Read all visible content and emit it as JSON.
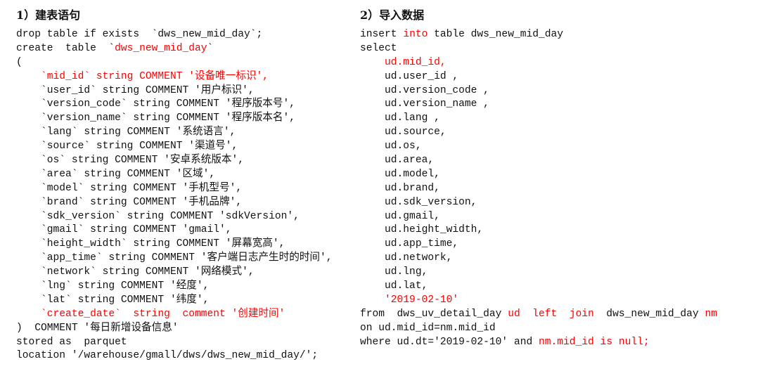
{
  "colors": {
    "keyword_highlight": "#ff0000",
    "text": "#111111"
  },
  "left": {
    "heading": "1）建表语句",
    "lines": [
      [
        {
          "t": "drop table if exists  `dws_new_mid_day`;"
        }
      ],
      [
        {
          "t": "create  table  `"
        },
        {
          "t": "dws_new_mid_day",
          "red": true
        },
        {
          "t": "`"
        }
      ],
      [
        {
          "t": "("
        }
      ],
      [
        {
          "t": "    "
        },
        {
          "t": "`mid_id` string COMMENT '设备唯一标识',",
          "red": true
        }
      ],
      [
        {
          "t": "    `user_id` string COMMENT '用户标识',"
        }
      ],
      [
        {
          "t": "    `version_code` string COMMENT '程序版本号',"
        }
      ],
      [
        {
          "t": "    `version_name` string COMMENT '程序版本名',"
        }
      ],
      [
        {
          "t": "    `lang` string COMMENT '系统语言',"
        }
      ],
      [
        {
          "t": "    `source` string COMMENT '渠道号',"
        }
      ],
      [
        {
          "t": "    `os` string COMMENT '安卓系统版本',"
        }
      ],
      [
        {
          "t": "    `area` string COMMENT '区域',"
        }
      ],
      [
        {
          "t": "    `model` string COMMENT '手机型号',"
        }
      ],
      [
        {
          "t": "    `brand` string COMMENT '手机品牌',"
        }
      ],
      [
        {
          "t": "    `sdk_version` string COMMENT 'sdkVersion',"
        }
      ],
      [
        {
          "t": "    `gmail` string COMMENT 'gmail',"
        }
      ],
      [
        {
          "t": "    `height_width` string COMMENT '屏幕宽高',"
        }
      ],
      [
        {
          "t": "    `app_time` string COMMENT '客户端日志产生时的时间',"
        }
      ],
      [
        {
          "t": "    `network` string COMMENT '网络模式',"
        }
      ],
      [
        {
          "t": "    `lng` string COMMENT '经度',"
        }
      ],
      [
        {
          "t": "    `lat` string COMMENT '纬度',"
        }
      ],
      [
        {
          "t": "    "
        },
        {
          "t": "`create_date`  string  comment '创建时间'",
          "red": true
        }
      ],
      [
        {
          "t": ")  COMMENT '每日新增设备信息'"
        }
      ],
      [
        {
          "t": "stored as  parquet"
        }
      ],
      [
        {
          "t": "location '/warehouse/gmall/dws/dws_new_mid_day/';"
        }
      ]
    ]
  },
  "right": {
    "heading": "2）导入数据",
    "lines": [
      [
        {
          "t": "insert "
        },
        {
          "t": "into",
          "red": true
        },
        {
          "t": " table dws_new_mid_day"
        }
      ],
      [
        {
          "t": "select"
        }
      ],
      [
        {
          "t": "    "
        },
        {
          "t": "ud.mid_id,",
          "red": true
        }
      ],
      [
        {
          "t": "    ud.user_id ,"
        }
      ],
      [
        {
          "t": "    ud.version_code ,"
        }
      ],
      [
        {
          "t": "    ud.version_name ,"
        }
      ],
      [
        {
          "t": "    ud.lang ,"
        }
      ],
      [
        {
          "t": "    ud.source,"
        }
      ],
      [
        {
          "t": "    ud.os,"
        }
      ],
      [
        {
          "t": "    ud.area,"
        }
      ],
      [
        {
          "t": "    ud.model,"
        }
      ],
      [
        {
          "t": "    ud.brand,"
        }
      ],
      [
        {
          "t": "    ud.sdk_version,"
        }
      ],
      [
        {
          "t": "    ud.gmail,"
        }
      ],
      [
        {
          "t": "    ud.height_width,"
        }
      ],
      [
        {
          "t": "    ud.app_time,"
        }
      ],
      [
        {
          "t": "    ud.network,"
        }
      ],
      [
        {
          "t": "    ud.lng,"
        }
      ],
      [
        {
          "t": "    ud.lat,"
        }
      ],
      [
        {
          "t": "    "
        },
        {
          "t": "'2019-02-10'",
          "red": true
        }
      ],
      [
        {
          "t": "from  dws_uv_detail_day "
        },
        {
          "t": "ud  left  join",
          "red": true
        },
        {
          "t": "  dws_new_mid_day "
        },
        {
          "t": "nm",
          "red": true
        }
      ],
      [
        {
          "t": "on ud.mid_id=nm.mid_id"
        }
      ],
      [
        {
          "t": "where ud.dt='2019-02-10' and "
        },
        {
          "t": "nm.mid_id is null;",
          "red": true
        }
      ]
    ]
  }
}
